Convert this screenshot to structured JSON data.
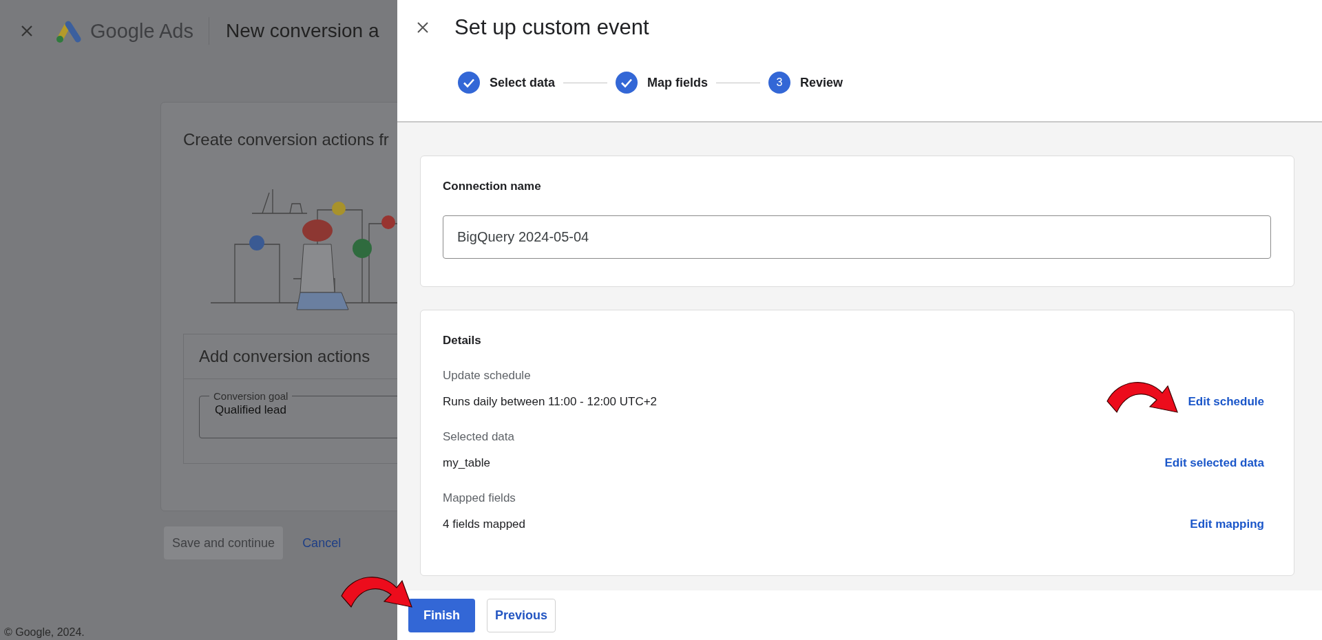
{
  "background": {
    "header": {
      "product": "Google Ads",
      "page_title": "New conversion a"
    },
    "card": {
      "title": "Create conversion actions fr",
      "section_title": "Add conversion actions",
      "goal_field": {
        "label": "Conversion goal",
        "value": "Qualified lead"
      }
    },
    "buttons": [
      {
        "label": "Save and continue",
        "disabled": true
      },
      {
        "label": "Cancel",
        "disabled": false
      }
    ],
    "footer": "© Google, 2024."
  },
  "panel": {
    "title": "Set up custom event",
    "steps": [
      {
        "label": "Select data",
        "done": true
      },
      {
        "label": "Map fields",
        "done": true
      },
      {
        "label": "Review",
        "done": false,
        "number": "3"
      }
    ],
    "connection": {
      "label": "Connection name",
      "value": "BigQuery 2024-05-04"
    },
    "details": {
      "title": "Details",
      "rows": [
        {
          "label": "Update schedule",
          "value": "Runs daily between 11:00 - 12:00 UTC+2",
          "action": "Edit schedule"
        },
        {
          "label": "Selected data",
          "value": "my_table",
          "action": "Edit selected data"
        },
        {
          "label": "Mapped fields",
          "value": "4 fields mapped",
          "action": "Edit mapping"
        }
      ]
    },
    "buttons": [
      {
        "label": "Finish",
        "kind": "primary"
      },
      {
        "label": "Previous",
        "kind": "secondary"
      }
    ]
  }
}
